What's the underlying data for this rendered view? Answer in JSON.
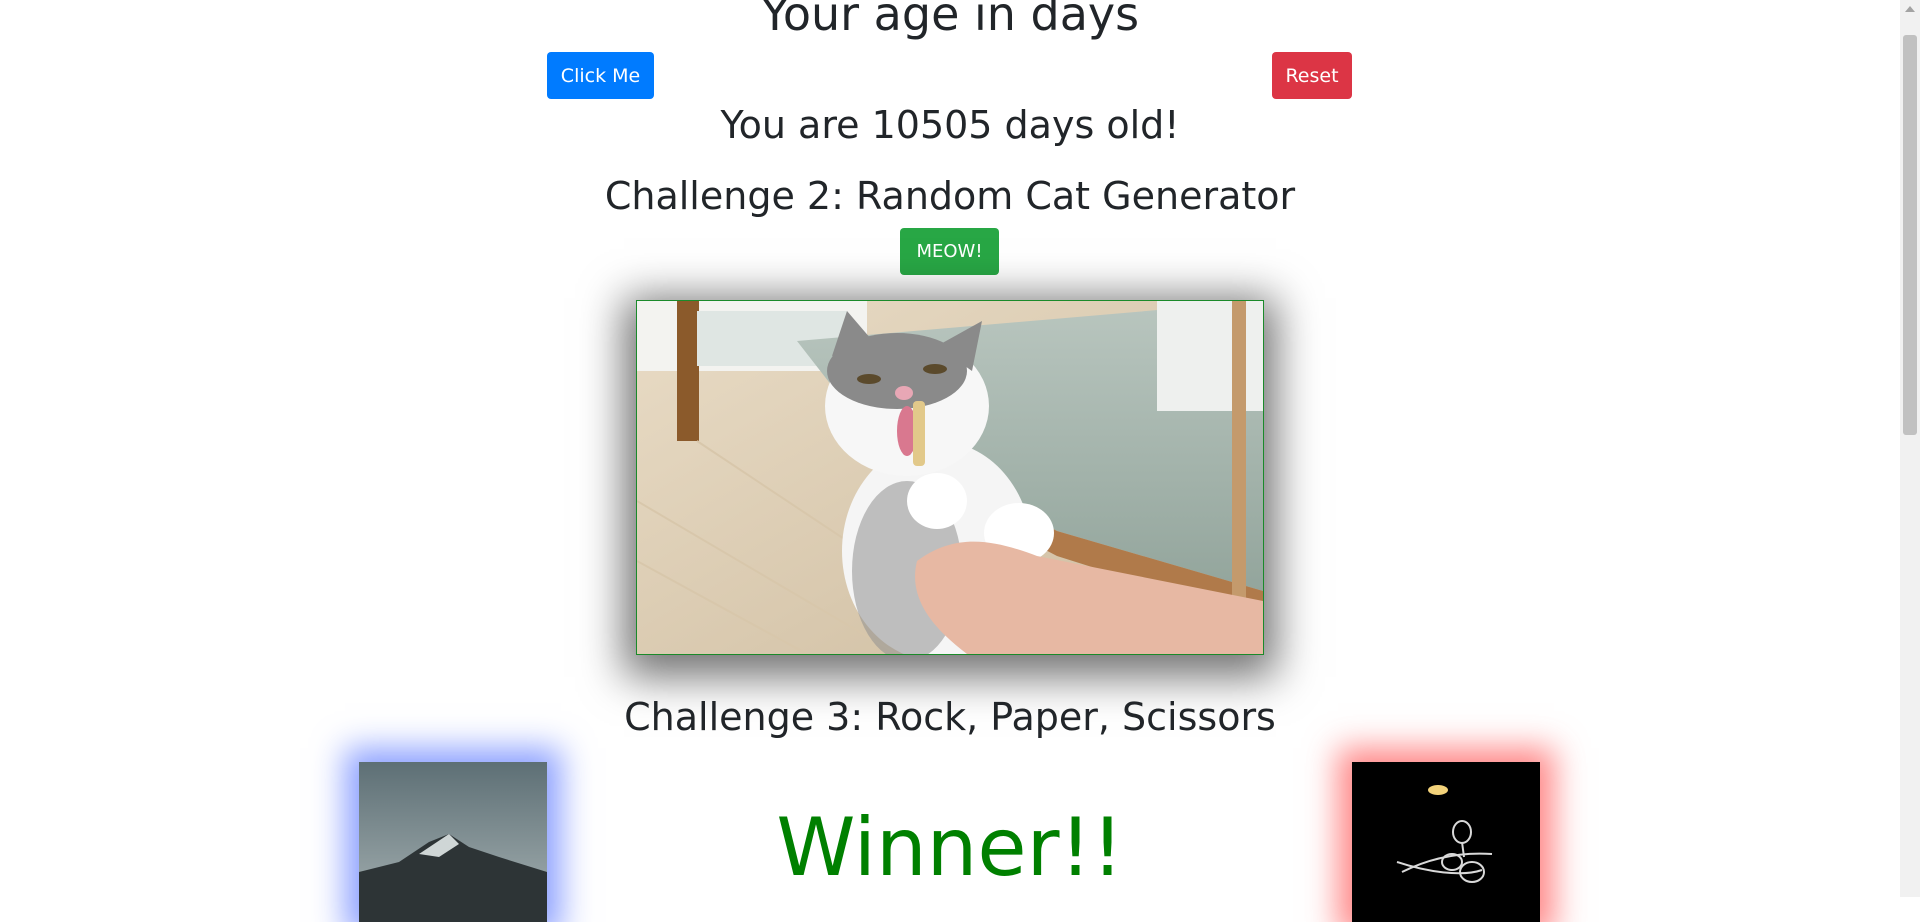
{
  "header": {
    "title": "Your age in days"
  },
  "challenge1": {
    "click_label": "Click Me",
    "reset_label": "Reset",
    "result": "You are 10505 days old!",
    "click_color": "#007bff",
    "reset_color": "#dc3545"
  },
  "challenge2": {
    "heading": "Challenge 2: Random Cat Generator",
    "meow_label": "MEOW!",
    "meow_color": "#28a745",
    "image_icon": "cat-photo"
  },
  "challenge3": {
    "heading": "Challenge 3: Rock, Paper, Scissors",
    "result": "Winner!!",
    "result_color": "#008000",
    "human_choice": "rock",
    "bot_choice": "scissors",
    "human_glow": "#506eff",
    "bot_glow": "#ff4646"
  }
}
